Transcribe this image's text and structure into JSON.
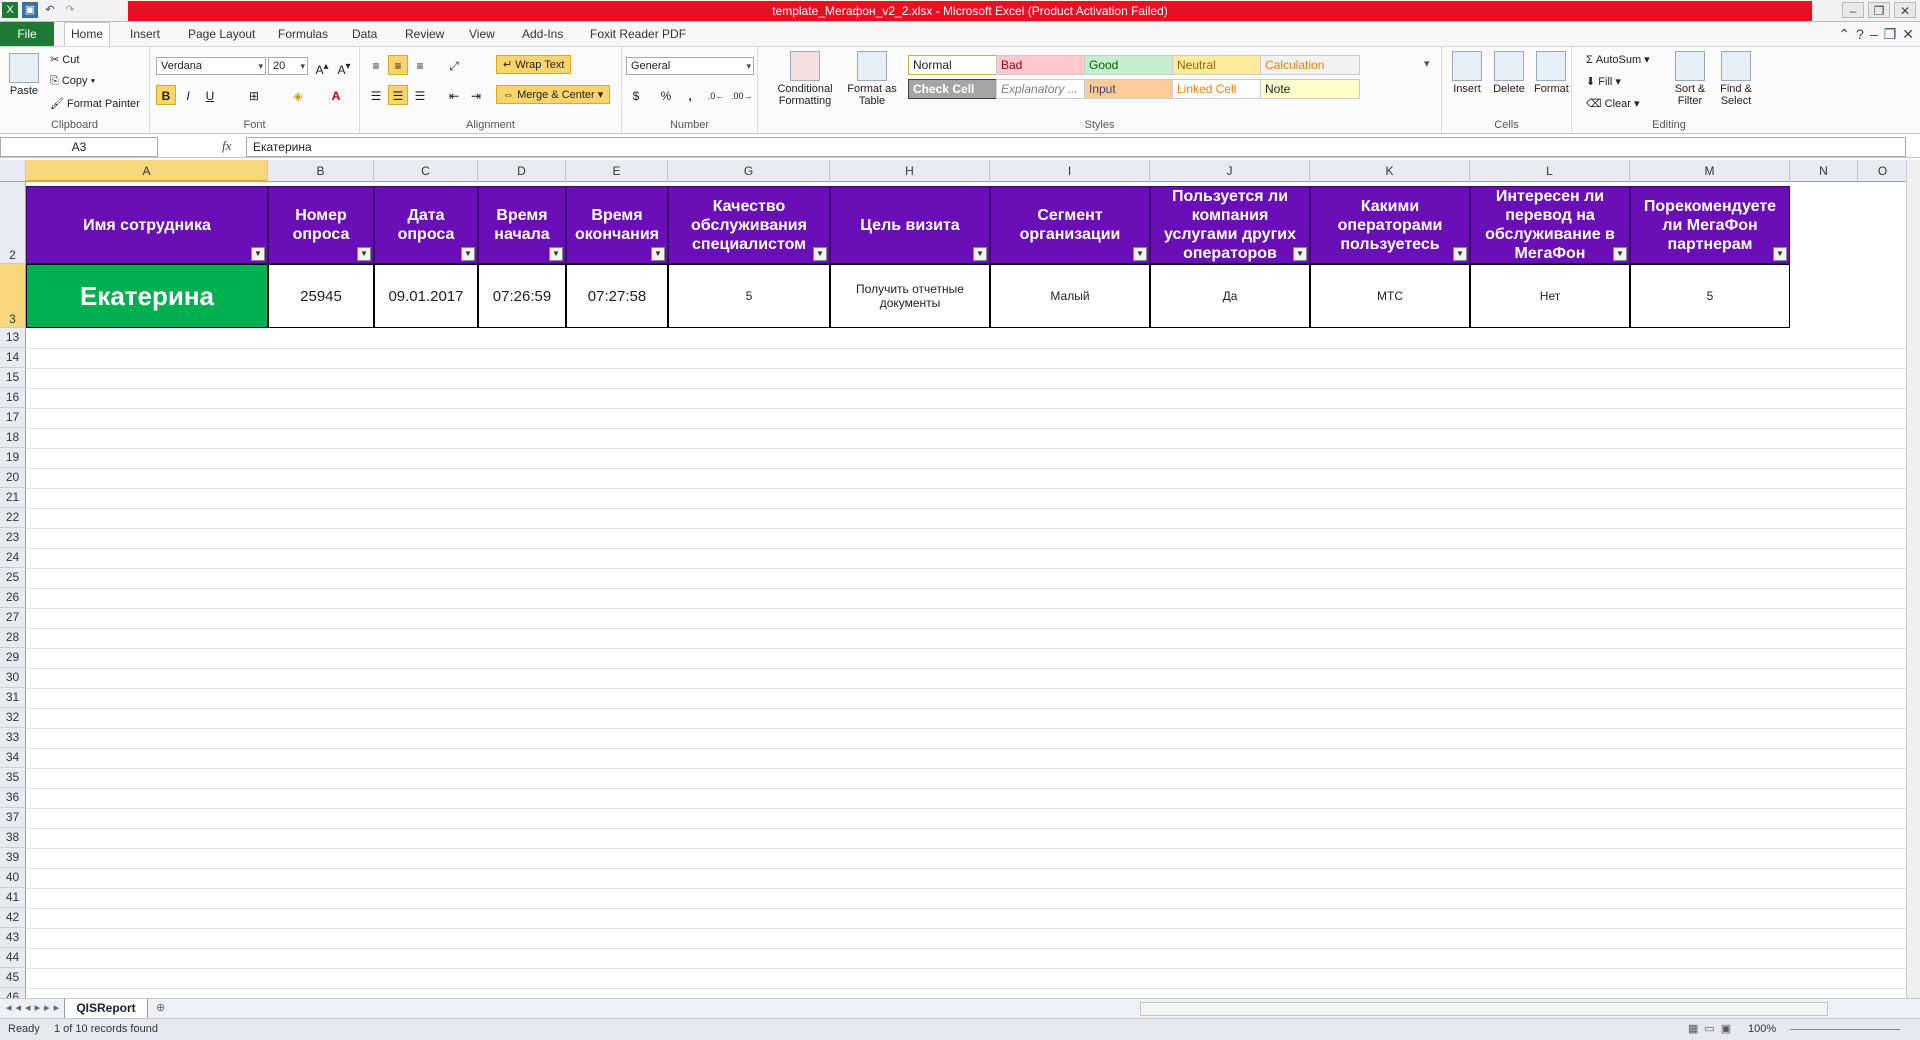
{
  "window": {
    "title": "template_Мегафон_v2_2.xlsx  -  Microsoft Excel (Product Activation Failed)"
  },
  "tabs": {
    "file": "File",
    "home": "Home",
    "insert": "Insert",
    "page_layout": "Page Layout",
    "formulas": "Formulas",
    "data": "Data",
    "review": "Review",
    "view": "View",
    "addins": "Add-Ins",
    "foxit": "Foxit Reader PDF"
  },
  "ribbon": {
    "clipboard": {
      "label": "Clipboard",
      "paste": "Paste",
      "cut": "Cut",
      "copy": "Copy",
      "format_painter": "Format Painter"
    },
    "font": {
      "label": "Font",
      "family": "Verdana",
      "size": "20",
      "bold": "B",
      "italic": "I",
      "underline": "U"
    },
    "alignment": {
      "label": "Alignment",
      "wrap": "Wrap Text",
      "merge": "Merge & Center"
    },
    "number": {
      "label": "Number",
      "format": "General",
      "percent": "%",
      "comma": ","
    },
    "styles": {
      "label": "Styles",
      "conditional": "Conditional Formatting",
      "format_table": "Format as Table",
      "items": [
        {
          "name": "Normal",
          "bg": "#ffffff"
        },
        {
          "name": "Bad",
          "bg": "#ffc7ce"
        },
        {
          "name": "Good",
          "bg": "#c6efce"
        },
        {
          "name": "Neutral",
          "bg": "#ffeb9c"
        },
        {
          "name": "Calculation",
          "bg": "#f2f2f2"
        },
        {
          "name": "Check Cell",
          "bg": "#a5a5a5"
        },
        {
          "name": "Explanatory ...",
          "bg": "#ffffff"
        },
        {
          "name": "Input",
          "bg": "#ffcc99"
        },
        {
          "name": "Linked Cell",
          "bg": "#ffffff"
        },
        {
          "name": "Note",
          "bg": "#ffffcc"
        }
      ]
    },
    "cells": {
      "label": "Cells",
      "insert": "Insert",
      "delete": "Delete",
      "format": "Format"
    },
    "editing": {
      "label": "Editing",
      "autosum": "AutoSum",
      "fill": "Fill",
      "clear": "Clear",
      "sort": "Sort & Filter",
      "find": "Find & Select"
    }
  },
  "formula_bar": {
    "name_box": "A3",
    "fx": "fx",
    "value": "Екатерина"
  },
  "columns": [
    "A",
    "B",
    "C",
    "D",
    "E",
    "G",
    "H",
    "I",
    "J",
    "K",
    "L",
    "M",
    "N",
    "O"
  ],
  "rows": [
    "2",
    "3",
    "13",
    "14",
    "15",
    "16",
    "17",
    "18",
    "19",
    "20",
    "21",
    "22",
    "23",
    "24",
    "25",
    "26",
    "27",
    "28",
    "29",
    "30",
    "31",
    "32",
    "33",
    "34",
    "35",
    "36",
    "37",
    "38",
    "39",
    "40",
    "41",
    "42",
    "43",
    "44",
    "45",
    "46"
  ],
  "headers": [
    "Имя сотрудника",
    "Номер опроса",
    "Дата опроса",
    "Время начала",
    "Время окончания",
    "Качество обслуживания специалистом",
    "Цель визита",
    "Сегмент организации",
    "Пользуется ли компания услугами других операторов",
    "Какими операторами пользуетесь",
    "Интересен ли перевод на обслуживание в МегаФон",
    "Порекомендуете ли МегаФон партнерам"
  ],
  "row3": [
    "Екатерина",
    "25945",
    "09.01.2017",
    "07:26:59",
    "07:27:58",
    "5",
    "Получить отчетные документы",
    "Малый",
    "Да",
    "МТС",
    "Нет",
    "5"
  ],
  "sheet": {
    "tab": "QISReport"
  },
  "status": {
    "ready": "Ready",
    "records": "1 of 10 records found",
    "zoom": "100%"
  },
  "colors": {
    "header_purple": "#6a0fb8",
    "name_green": "#00b050",
    "excel_green": "#1e7a34",
    "title_red": "#e81123"
  }
}
